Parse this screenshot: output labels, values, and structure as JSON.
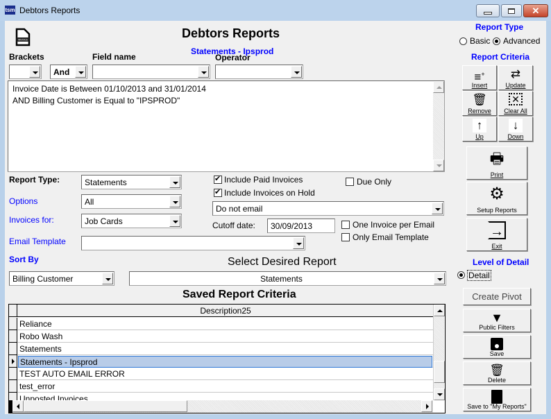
{
  "window": {
    "title": "Debtors Reports",
    "logo_text": "tsm",
    "controls": {
      "minimize": "minimize",
      "maximize": "maximize",
      "close": "✕"
    }
  },
  "header": {
    "title": "Debtors Reports",
    "subtitle": "Statements - Ipsprod",
    "icon": "invoice-document-icon"
  },
  "criteria_builder": {
    "brackets_label": "Brackets",
    "field_name_label": "Field name",
    "operator_label": "Operator",
    "brackets_value": "",
    "logic_value": "And",
    "field_value": "",
    "operator_value": "",
    "criteria_lines": [
      "Invoice Date is Between 01/10/2013 and 31/01/2014",
      "AND Billing Customer is Equal to  \"IPSPROD\""
    ]
  },
  "options": {
    "report_type_label": "Report Type:",
    "report_type_value": "Statements",
    "options_label": "Options",
    "options_value": "All",
    "invoices_for_label": "Invoices for:",
    "invoices_for_value": "Job Cards",
    "email_template_label": "Email Template",
    "email_template_value": "",
    "sort_by_label": "Sort By",
    "sort_by_value": "Billing Customer",
    "include_paid_label": "Include Paid Invoices",
    "include_paid_checked": true,
    "include_hold_label": "Include Invoices on Hold",
    "include_hold_checked": true,
    "due_only_label": "Due Only",
    "due_only_checked": false,
    "email_mode_value": "Do not email",
    "cutoff_label": "Cutoff date:",
    "cutoff_value": "30/09/2013",
    "one_invoice_label": "One Invoice per Email",
    "one_invoice_checked": false,
    "only_template_label": "Only Email Template",
    "only_template_checked": false,
    "select_report_label": "Select Desired Report",
    "select_report_value": "Statements"
  },
  "saved_criteria": {
    "title": "Saved Report Criteria",
    "column_header": "Description25",
    "rows": [
      {
        "label": "Reliance",
        "selected": false
      },
      {
        "label": "Robo Wash",
        "selected": false
      },
      {
        "label": "Statements",
        "selected": false
      },
      {
        "label": "Statements - Ipsprod",
        "selected": true
      },
      {
        "label": "TEST AUTO EMAIL ERROR",
        "selected": false
      },
      {
        "label": "test_error",
        "selected": false
      },
      {
        "label": "Unposted Invoices",
        "selected": false
      }
    ]
  },
  "sidebar": {
    "report_type_title": "Report Type",
    "basic_label": "Basic",
    "advanced_label": "Advanced",
    "report_type_selected": "Advanced",
    "report_criteria_title": "Report Criteria",
    "insert_label": "Insert",
    "update_label": "Update",
    "remove_label": "Remove",
    "clear_all_label": "Clear All",
    "up_label": "Up",
    "down_label": "Down",
    "print_label": "Print",
    "setup_reports_label": "Setup Reports",
    "exit_label": "Exit",
    "level_of_detail_title": "Level of Detail",
    "detail_label": "Detail",
    "create_pivot_label": "Create Pivot",
    "public_filters_label": "Public Filters",
    "save_label": "Save",
    "delete_label": "Delete",
    "save_my_reports_label": "Save to \"My Reports\""
  }
}
